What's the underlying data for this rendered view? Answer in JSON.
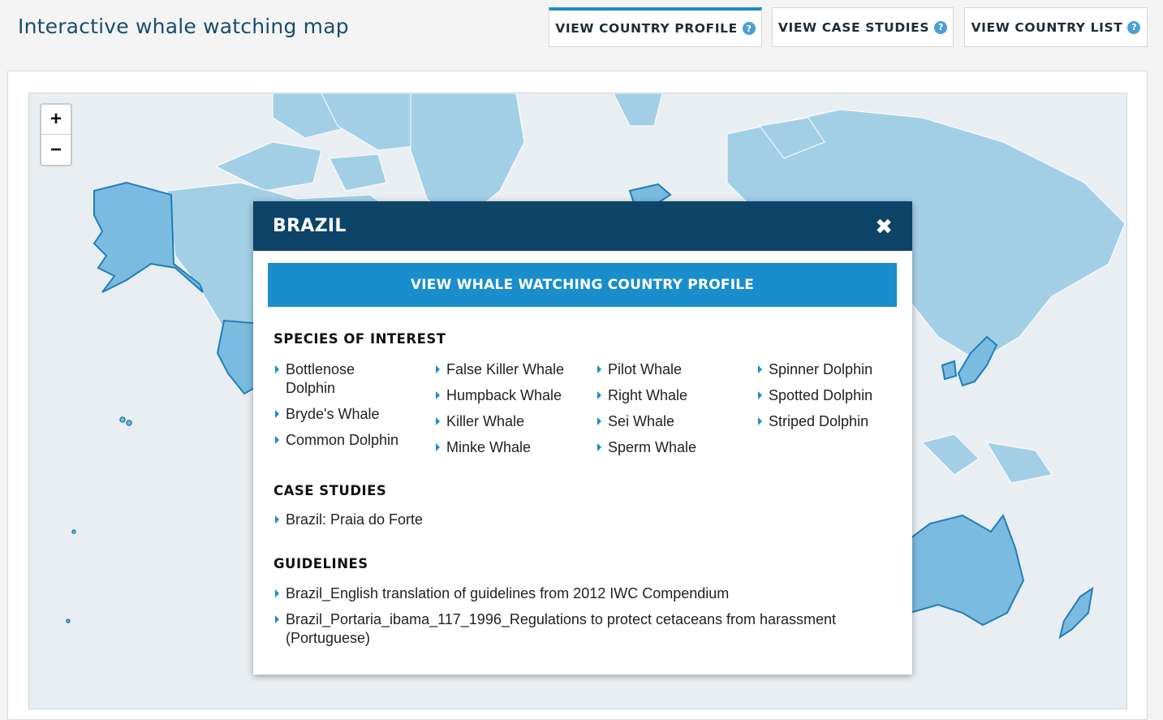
{
  "header": {
    "title": "Interactive whale watching map",
    "tabs": [
      {
        "label": "VIEW COUNTRY PROFILE",
        "help": "?"
      },
      {
        "label": "VIEW CASE STUDIES",
        "help": "?"
      },
      {
        "label": "VIEW COUNTRY LIST",
        "help": "?"
      }
    ]
  },
  "map": {
    "zoom_in": "+",
    "zoom_out": "−",
    "colors": {
      "ocean": "#e9eef2",
      "land": "#a3cfe6",
      "highlight": "#7bbbdf",
      "border": "#1f7fb8"
    }
  },
  "popup": {
    "title": "BRAZIL",
    "close": "✖",
    "cta": "VIEW WHALE WATCHING COUNTRY PROFILE",
    "species_heading": "SPECIES OF INTEREST",
    "species": [
      [
        "Bottlenose Dolphin",
        "Bryde's Whale",
        "Common Dolphin"
      ],
      [
        "False Killer Whale",
        "Humpback Whale",
        "Killer Whale",
        "Minke Whale"
      ],
      [
        "Pilot Whale",
        "Right Whale",
        "Sei Whale",
        "Sperm Whale"
      ],
      [
        "Spinner Dolphin",
        "Spotted Dolphin",
        "Striped Dolphin"
      ]
    ],
    "case_heading": "CASE STUDIES",
    "case_studies": [
      "Brazil: Praia do Forte"
    ],
    "guidelines_heading": "GUIDELINES",
    "guidelines": [
      "Brazil_English translation of guidelines from 2012 IWC Compendium",
      "Brazil_Portaria_ibama_117_1996_Regulations to protect cetaceans from harassment (Portuguese)"
    ]
  }
}
